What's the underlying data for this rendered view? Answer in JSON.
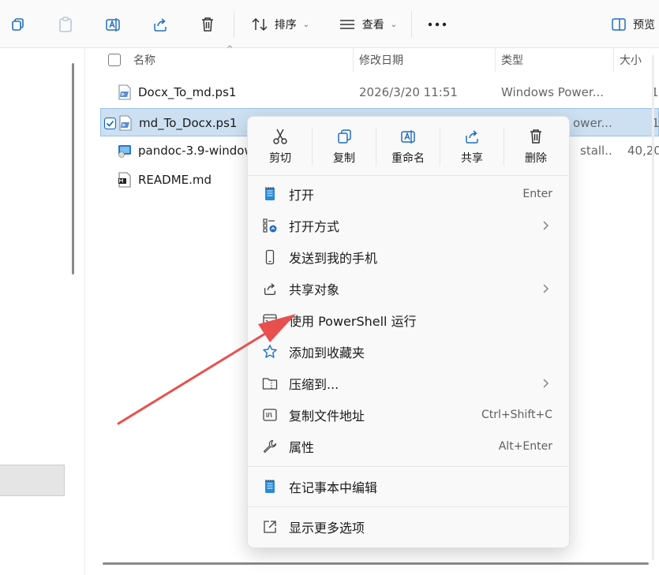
{
  "toolbar": {
    "sort_label": "排序",
    "view_label": "查看",
    "preview_label": "预览"
  },
  "columns": {
    "name": "名称",
    "modified": "修改日期",
    "type": "类型",
    "size": "大小"
  },
  "files": [
    {
      "name": "Docx_To_md.ps1",
      "modified": "2026/3/20 11:51",
      "type": "Windows Power...",
      "size": "1"
    },
    {
      "name": "md_To_Docx.ps1",
      "modified": "",
      "type": "ower...",
      "size": "1"
    },
    {
      "name": "pandoc-3.9-window",
      "modified": "",
      "type": "stall...",
      "size": "40,20"
    },
    {
      "name": "README.md",
      "modified": "",
      "type": "",
      "size": ""
    }
  ],
  "context_menu": {
    "quick_actions": [
      {
        "label": "剪切",
        "icon": "scissors-icon"
      },
      {
        "label": "复制",
        "icon": "copy-icon"
      },
      {
        "label": "重命名",
        "icon": "rename-icon"
      },
      {
        "label": "共享",
        "icon": "share-icon"
      },
      {
        "label": "删除",
        "icon": "trash-icon"
      }
    ],
    "items": [
      {
        "label": "打开",
        "shortcut": "Enter",
        "icon": "notepad-icon"
      },
      {
        "label": "打开方式",
        "shortcut": "",
        "icon": "open-with-icon"
      },
      {
        "label": "发送到我的手机",
        "shortcut": "",
        "icon": "phone-icon"
      },
      {
        "label": "共享对象",
        "shortcut": "",
        "icon": "share-icon"
      },
      {
        "label": "使用 PowerShell 运行",
        "shortcut": "",
        "icon": "powershell-icon"
      },
      {
        "label": "添加到收藏夹",
        "shortcut": "",
        "icon": "star-icon"
      },
      {
        "label": "压缩到...",
        "shortcut": "",
        "icon": "zip-folder-icon"
      },
      {
        "label": "复制文件地址",
        "shortcut": "Ctrl+Shift+C",
        "icon": "copy-path-icon"
      },
      {
        "label": "属性",
        "shortcut": "Alt+Enter",
        "icon": "wrench-icon"
      }
    ],
    "notepad_item": {
      "label": "在记事本中编辑",
      "icon": "notepad-icon"
    },
    "more_item": {
      "label": "显示更多选项",
      "icon": "more-options-icon"
    }
  },
  "colors": {
    "accent": "#0067c0",
    "selection": "#cce0f2",
    "annotation_arrow": "#e8504f"
  }
}
